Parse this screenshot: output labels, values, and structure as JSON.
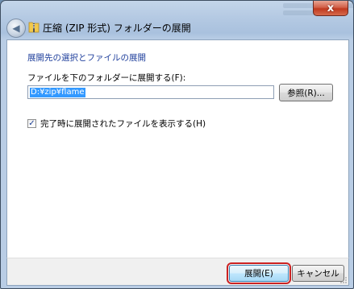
{
  "window": {
    "title": "圧縮 (ZIP 形式) フォルダーの展開",
    "close_label": "x"
  },
  "content": {
    "heading": "展開先の選択とファイルの展開",
    "field_label": "ファイルを下のフォルダーに展開する(F):",
    "path_value": "D:¥zip¥flame",
    "browse_label": "参照(R)...",
    "show_files_checked": true,
    "show_files_label": "完了時に展開されたファイルを表示する(H)"
  },
  "footer": {
    "extract_label": "展開(E)",
    "cancel_label": "キャンセル"
  },
  "colors": {
    "heading": "#1f3f9c",
    "selection": "#3399ff",
    "highlight_outline": "#cc2222"
  }
}
